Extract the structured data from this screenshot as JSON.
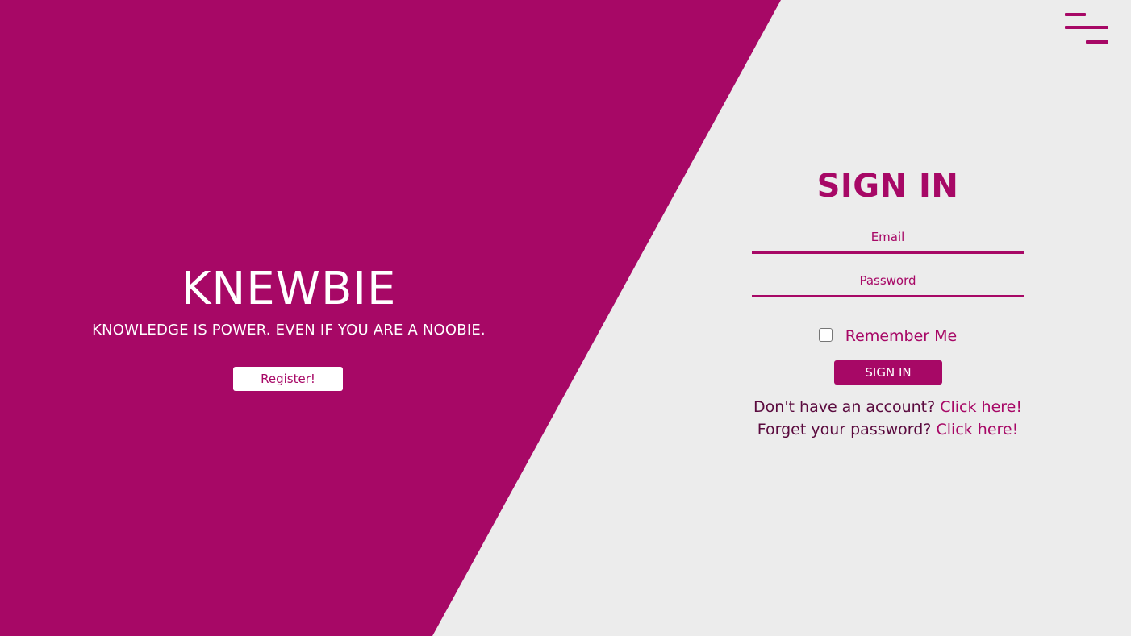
{
  "colors": {
    "accent": "#a70866",
    "background": "#ececec",
    "text_on_accent": "#ffffff",
    "dark_text": "#5a0a3e"
  },
  "header": {
    "menu_icon": "hamburger-menu-icon"
  },
  "brand": {
    "title": "KNEWBIE",
    "tagline": "KNOWLEDGE IS POWER. EVEN IF YOU ARE A NOOBIE.",
    "register_label": "Register!"
  },
  "signin": {
    "title": "SIGN IN",
    "email_placeholder": "Email",
    "email_value": "",
    "password_placeholder": "Password",
    "password_value": "",
    "remember_label": "Remember Me",
    "remember_checked": false,
    "submit_label": "SIGN IN",
    "no_account_text": "Don't have an account?",
    "no_account_link": "Click here!",
    "forgot_text": "Forget your password?",
    "forgot_link": "Click here!"
  }
}
